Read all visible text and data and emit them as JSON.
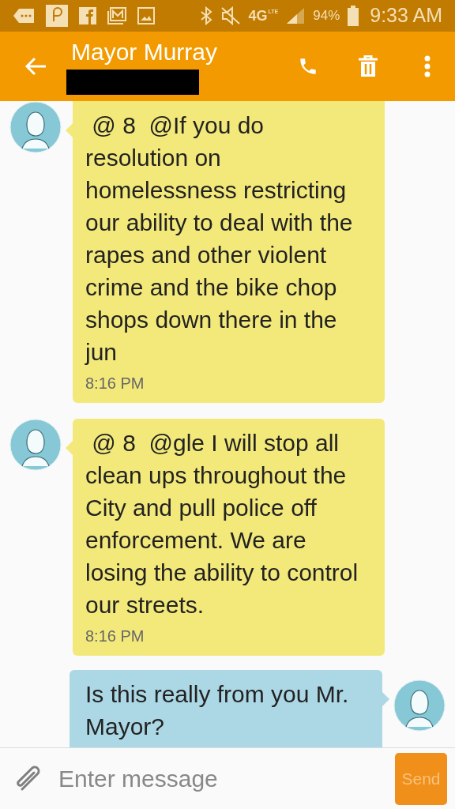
{
  "status_bar": {
    "battery": "94%",
    "time": "9:33 AM",
    "network": "4G",
    "network_sub": "LTE"
  },
  "header": {
    "title": "Mayor Murray",
    "subtitle_redacted": true
  },
  "messages": [
    {
      "kind": "incoming",
      "text": " @ 8  @If you do resolution on homelessness restricting our ability to deal with the rapes and other violent crime and the bike chop shops down there in the jun",
      "time": "8:16 PM"
    },
    {
      "kind": "incoming",
      "text": " @ 8  @gle I will stop all clean ups throughout the City and pull police off enforcement. We are losing the ability to control our streets.",
      "time": "8:16 PM"
    },
    {
      "kind": "outgoing",
      "text": "Is this really from you Mr. Mayor?"
    }
  ],
  "composer": {
    "placeholder": "Enter message",
    "send_label": "Send"
  }
}
